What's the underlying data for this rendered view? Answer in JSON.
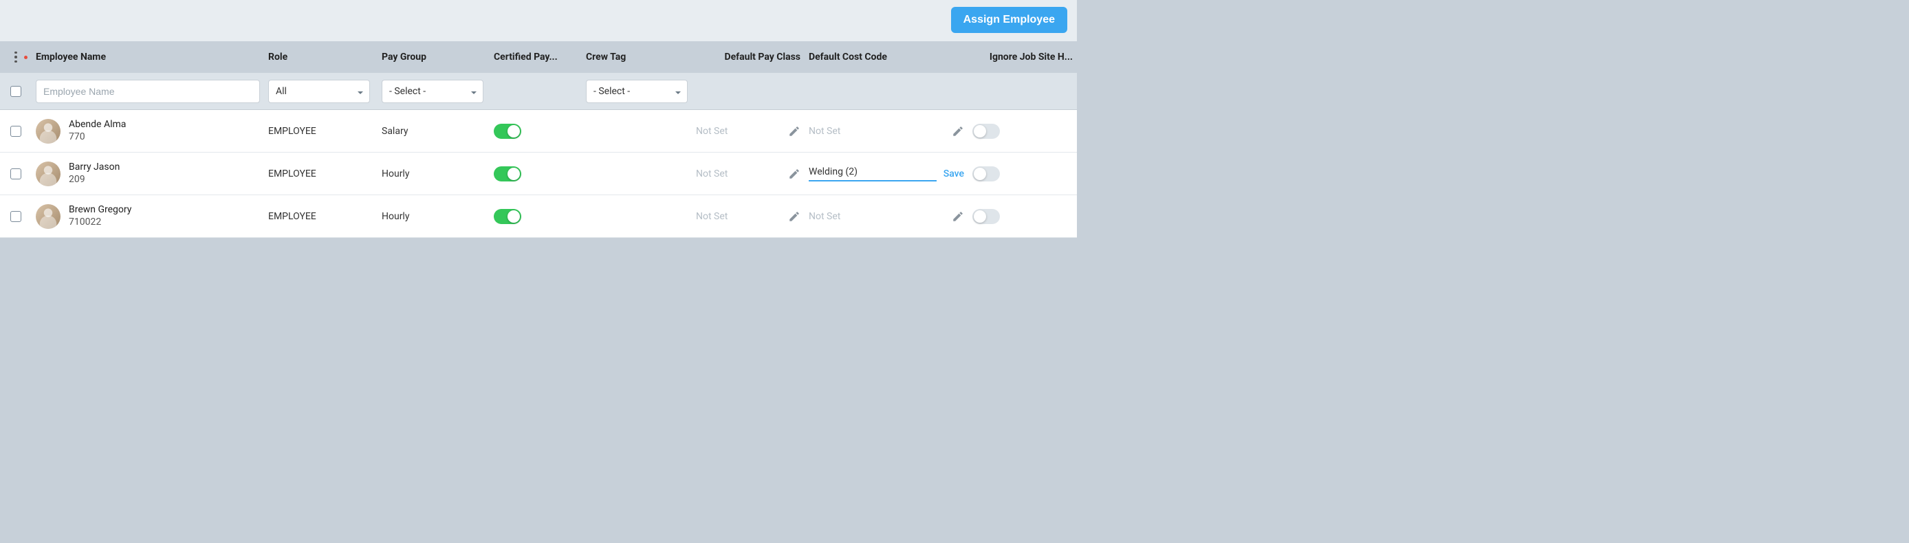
{
  "toolbar": {
    "assign_label": "Assign Employee"
  },
  "columns": {
    "employee_name": "Employee Name",
    "role": "Role",
    "pay_group": "Pay Group",
    "certified_pay": "Certified Pay...",
    "crew_tag": "Crew Tag",
    "default_pay_class": "Default Pay Class",
    "default_cost_code": "Default Cost Code",
    "ignore_job_site": "Ignore Job Site H..."
  },
  "filters": {
    "employee_name_placeholder": "Employee Name",
    "role_value": "All",
    "pay_group_value": "- Select -",
    "crew_tag_value": "- Select -"
  },
  "rows": [
    {
      "name": "Abende Alma",
      "id": "770",
      "role": "EMPLOYEE",
      "pay_group": "Salary",
      "certified_on": true,
      "default_pay_class": "Not Set",
      "default_cost_code": "Not Set",
      "cost_code_editing": false,
      "ignore_job_site_on": false
    },
    {
      "name": "Barry Jason",
      "id": "209",
      "role": "EMPLOYEE",
      "pay_group": "Hourly",
      "certified_on": true,
      "default_pay_class": "Not Set",
      "default_cost_code": "Welding (2)",
      "cost_code_editing": true,
      "save_label": "Save",
      "ignore_job_site_on": false
    },
    {
      "name": "Brewn Gregory",
      "id": "710022",
      "role": "EMPLOYEE",
      "pay_group": "Hourly",
      "certified_on": true,
      "default_pay_class": "Not Set",
      "default_cost_code": "Not Set",
      "cost_code_editing": false,
      "ignore_job_site_on": false
    }
  ]
}
